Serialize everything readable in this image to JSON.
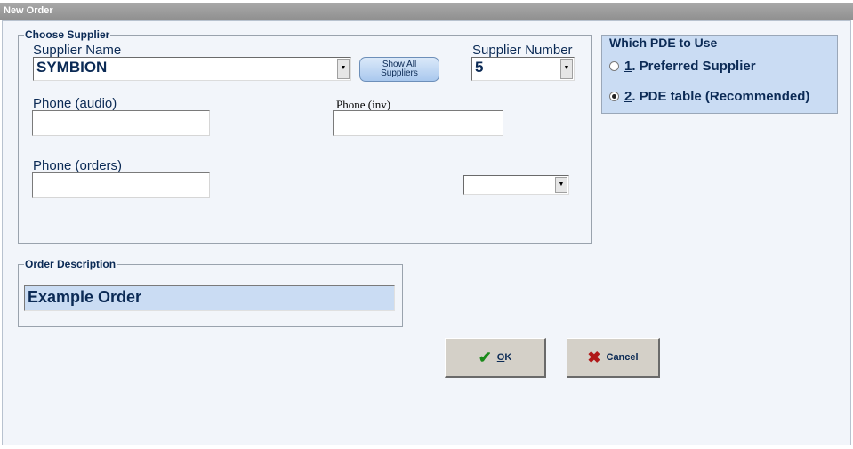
{
  "window": {
    "title": "New Order"
  },
  "supplier": {
    "legend": "Choose Supplier",
    "name_label": "Supplier Name",
    "name_value": "SYMBION",
    "show_all_line1": "Show All",
    "show_all_line2": "Suppliers",
    "number_label": "Supplier Number",
    "number_value": "5",
    "phone_audio_label": "Phone (audio)",
    "phone_audio_value": "",
    "phone_inv_label": "Phone (inv)",
    "phone_inv_value": "",
    "phone_orders_label": "Phone (orders)",
    "phone_orders_value": "",
    "extra_select_value": ""
  },
  "pde": {
    "title": "Which PDE to Use",
    "options": [
      {
        "key": "1",
        "label": ". Preferred Supplier",
        "selected": false
      },
      {
        "key": "2",
        "label": ". PDE table (Recommended)",
        "selected": true
      }
    ]
  },
  "order": {
    "legend": "Order Description",
    "value": "Example Order"
  },
  "buttons": {
    "ok_key": "O",
    "ok_rest": "K",
    "cancel": "Cancel"
  },
  "icons": {
    "ok": "check-icon",
    "cancel": "x-icon",
    "dropdown": "chevron-down-icon"
  },
  "colors": {
    "ok_icon": "#1a8a1a",
    "cancel_icon": "#b01818",
    "pde_panel": "#cadcf3",
    "label_text": "#0b2a55"
  }
}
